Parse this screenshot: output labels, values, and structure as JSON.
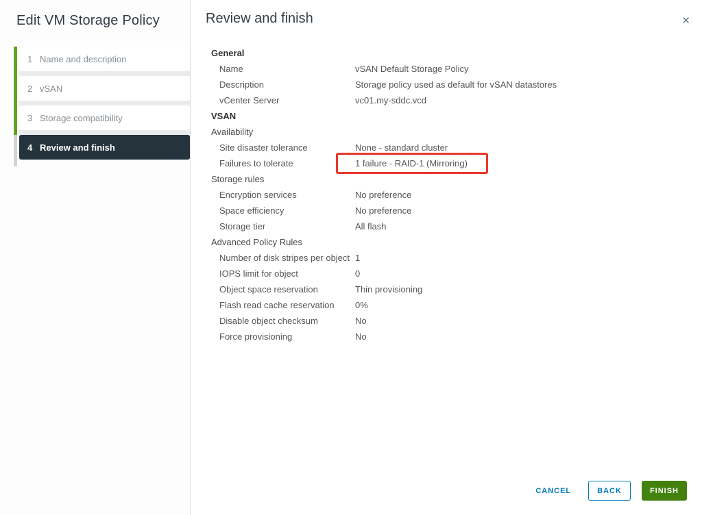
{
  "sidebar": {
    "title": "Edit VM Storage Policy",
    "steps": [
      {
        "number": "1",
        "label": "Name and description",
        "active": false
      },
      {
        "number": "2",
        "label": "vSAN",
        "active": false
      },
      {
        "number": "3",
        "label": "Storage compatibility",
        "active": false
      },
      {
        "number": "4",
        "label": "Review and finish",
        "active": true
      }
    ]
  },
  "main": {
    "title": "Review and finish",
    "sections": [
      {
        "header": "General",
        "bold": true,
        "rows": [
          {
            "label": "Name",
            "value": "vSAN Default Storage Policy"
          },
          {
            "label": "Description",
            "value": "Storage policy used as default for vSAN datastores"
          },
          {
            "label": "vCenter Server",
            "value": "vc01.my-sddc.vcd"
          }
        ]
      },
      {
        "header": "VSAN",
        "bold": true,
        "rows": []
      },
      {
        "header": "Availability",
        "bold": false,
        "rows": [
          {
            "label": "Site disaster tolerance",
            "value": "None - standard cluster"
          },
          {
            "label": "Failures to tolerate",
            "value": "1 failure - RAID-1 (Mirroring)",
            "highlighted": true
          }
        ]
      },
      {
        "header": "Storage rules",
        "bold": false,
        "rows": [
          {
            "label": "Encryption services",
            "value": "No preference"
          },
          {
            "label": "Space efficiency",
            "value": "No preference"
          },
          {
            "label": "Storage tier",
            "value": "All flash"
          }
        ]
      },
      {
        "header": "Advanced Policy Rules",
        "bold": false,
        "rows": [
          {
            "label": "Number of disk stripes per object",
            "value": "1"
          },
          {
            "label": "IOPS limit for object",
            "value": "0"
          },
          {
            "label": "Object space reservation",
            "value": "Thin provisioning"
          },
          {
            "label": "Flash read cache reservation",
            "value": "0%"
          },
          {
            "label": "Disable object checksum",
            "value": "No"
          },
          {
            "label": "Force provisioning",
            "value": "No"
          }
        ]
      }
    ]
  },
  "footer": {
    "cancel_label": "CANCEL",
    "back_label": "BACK",
    "finish_label": "FINISH"
  },
  "icons": {
    "close": "✕"
  },
  "colors": {
    "accent_blue": "#0079B8",
    "success_green": "#42810E",
    "progress_green": "#62A420",
    "active_step_bg": "#25333D",
    "highlight_red": "#E8392B"
  }
}
